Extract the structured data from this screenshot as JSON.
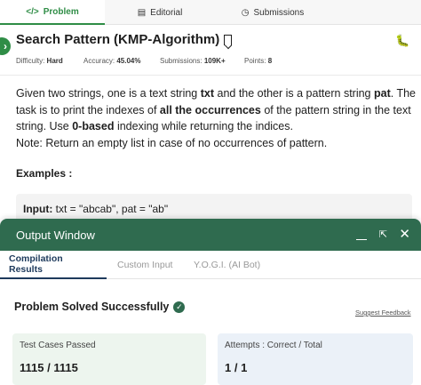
{
  "tabs": [
    {
      "label": "Problem",
      "icon": "code-icon"
    },
    {
      "label": "Editorial",
      "icon": "document-icon"
    },
    {
      "label": "Submissions",
      "icon": "clock-icon"
    }
  ],
  "problem": {
    "title": "Search Pattern (KMP-Algorithm)",
    "meta": {
      "difficulty_label": "Difficulty:",
      "difficulty_value": "Hard",
      "accuracy_label": "Accuracy:",
      "accuracy_value": "45.04%",
      "submissions_label": "Submissions:",
      "submissions_value": "109K+",
      "points_label": "Points:",
      "points_value": "8"
    },
    "desc": {
      "p1": "Given two strings, one is a text string ",
      "b1": "txt",
      "p2": " and the other is a pattern string ",
      "b2": "pat",
      "p3": ". The task is to print the indexes of ",
      "b3": "all the occurrences",
      "p4": " of the pattern string in the text string. Use ",
      "b4": "0-based",
      "p5": " indexing while returning the indices.",
      "note": "Note: Return an empty list in case of no occurrences of pattern."
    },
    "examples_label": "Examples :",
    "example_input_label": "Input:",
    "example_input_value": " txt = \"abcab\", pat = \"ab\""
  },
  "output_window": {
    "title": "Output Window",
    "tabs": [
      {
        "label": "Compilation Results"
      },
      {
        "label": "Custom Input"
      },
      {
        "label": "Y.O.G.I. (AI Bot)"
      }
    ],
    "status": "Problem Solved Successfully",
    "feedback": "Suggest Feedback",
    "cards": [
      {
        "label": "Test Cases Passed",
        "value": "1115 / 1115"
      },
      {
        "label": "Attempts : Correct / Total",
        "value": "1 / 1"
      }
    ]
  },
  "colors": {
    "accent": "#2f8d46",
    "header": "#2f6b4f",
    "active_tab": "#1e3a5c"
  }
}
